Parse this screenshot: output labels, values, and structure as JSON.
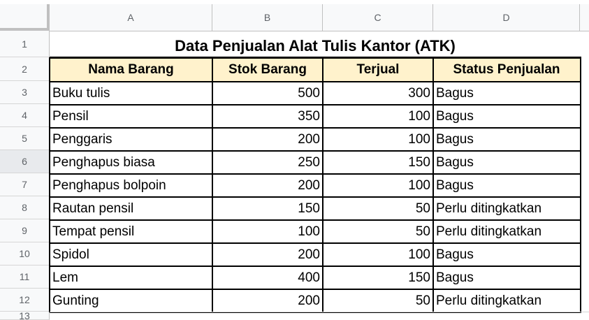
{
  "columns": [
    "A",
    "B",
    "C",
    "D"
  ],
  "row_numbers": [
    "1",
    "2",
    "3",
    "4",
    "5",
    "6",
    "7",
    "8",
    "9",
    "10",
    "11",
    "12",
    "13"
  ],
  "selected_row": "6",
  "title": "Data Penjualan Alat Tulis Kantor (ATK)",
  "headers": {
    "nama": "Nama Barang",
    "stok": "Stok Barang",
    "terjual": "Terjual",
    "status": "Status Penjualan"
  },
  "header_fill_color": "#fff2cc",
  "rows": [
    {
      "nama": "Buku tulis",
      "stok": "500",
      "terjual": "300",
      "status": "Bagus"
    },
    {
      "nama": "Pensil",
      "stok": "350",
      "terjual": "100",
      "status": "Bagus"
    },
    {
      "nama": "Penggaris",
      "stok": "200",
      "terjual": "100",
      "status": "Bagus"
    },
    {
      "nama": "Penghapus biasa",
      "stok": "250",
      "terjual": "150",
      "status": "Bagus"
    },
    {
      "nama": "Penghapus bolpoin",
      "stok": "200",
      "terjual": "100",
      "status": "Bagus"
    },
    {
      "nama": "Rautan pensil",
      "stok": "150",
      "terjual": "50",
      "status": "Perlu ditingkatkan"
    },
    {
      "nama": "Tempat pensil",
      "stok": "100",
      "terjual": "50",
      "status": "Perlu ditingkatkan"
    },
    {
      "nama": "Spidol",
      "stok": "200",
      "terjual": "100",
      "status": "Bagus"
    },
    {
      "nama": "Lem",
      "stok": "400",
      "terjual": "150",
      "status": "Bagus"
    },
    {
      "nama": "Gunting",
      "stok": "200",
      "terjual": "50",
      "status": "Perlu ditingkatkan"
    }
  ]
}
